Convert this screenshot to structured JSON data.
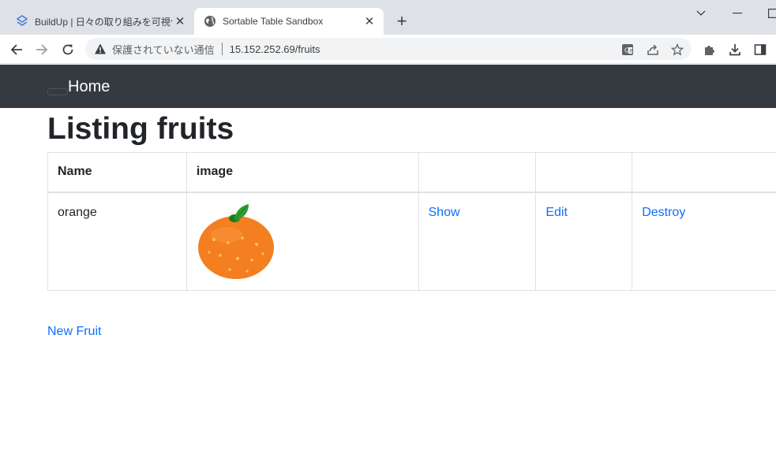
{
  "browser": {
    "tabs": [
      {
        "title": "BuildUp | 日々の取り組みを可視化",
        "active": false
      },
      {
        "title": "Sortable Table Sandbox",
        "active": true
      }
    ],
    "address": {
      "security_text": "保護されていない通信",
      "url": "15.152.252.69/fruits"
    }
  },
  "navbar": {
    "brand": "Home"
  },
  "page": {
    "title": "Listing fruits",
    "table": {
      "headers": [
        "Name",
        "image",
        "",
        "",
        ""
      ],
      "rows": [
        {
          "name": "orange",
          "image": "orange-illustration",
          "show": "Show",
          "edit": "Edit",
          "destroy": "Destroy"
        }
      ]
    },
    "new_link": "New Fruit"
  },
  "colors": {
    "navbar_bg": "#343a40",
    "link": "#0d6efd",
    "tabbar_bg": "#dee1e6",
    "orange_fruit": "#f47f20",
    "leaf": "#2e8b2e"
  }
}
